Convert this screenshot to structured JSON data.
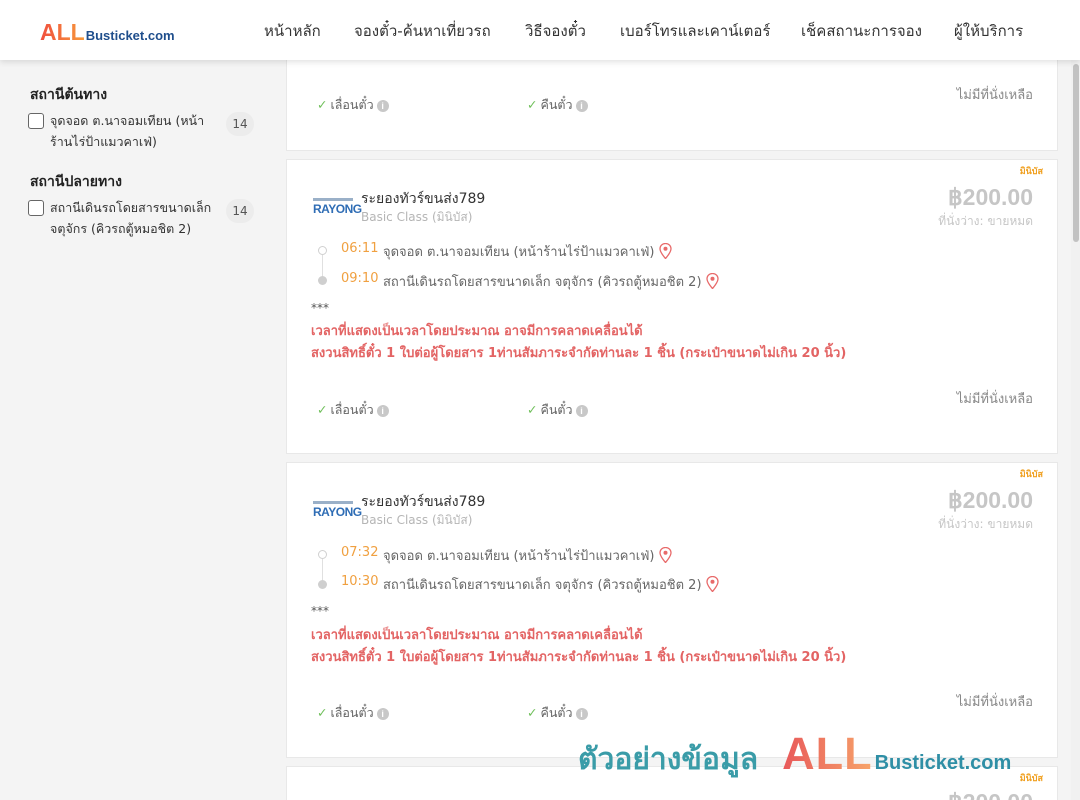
{
  "header": {
    "logo_all": "ALL",
    "logo_rest": "Busticket.com",
    "nav": [
      "หน้าหลัก",
      "จองตั๋ว-ค้นหาเที่ยวรถ",
      "วิธีจองตั๋ว",
      "เบอร์โทรและเคาน์เตอร์",
      "เช็คสถานะการจอง",
      "ผู้ให้บริการ"
    ]
  },
  "sidebar": {
    "origin_heading": "สถานีต้นทาง",
    "origin_label": "จุดจอด ต.นาจอมเทียน (หน้าร้านไร่ป้าแมวคาเฟ่)",
    "origin_count": "14",
    "dest_heading": "สถานีปลายทาง",
    "dest_label": "สถานีเดินรถโดยสารขนาดเล็ก จตุจักร (คิวรถตู้หมอชิต 2)",
    "dest_count": "14"
  },
  "common": {
    "badge": "มินิบัส",
    "operator_logo": "RAYONG",
    "operator": "ระยองทัวร์ขนส่ง789",
    "class": "Basic Class (มินิบัส)",
    "price": "฿200.00",
    "seats": "ที่นั่งว่าง: ขายหมด",
    "from_stop": "จุดจอด ต.นาจอมเทียน (หน้าร้านไร่ป้าแมวคาเฟ่)",
    "to_stop": "สถานีเดินรถโดยสารขนาดเล็ก จตุจักร (คิวรถตู้หมอชิต 2)",
    "stars": "***",
    "note1": "เวลาที่แสดงเป็นเวลาโดยประมาณ อาจมีการคลาดเคลื่อนได้",
    "note2": "สงวนสิทธิ์ตั๋ว 1 ใบต่อผู้โดยสาร 1ท่านสัมภาระจำกัดท่านละ 1 ชิ้น (กระเป๋าขนาดไม่เกิน 20 นิ้ว)",
    "reschedule": "เลื่อนตั๋ว",
    "refund": "คืนตั๋ว",
    "no_seat": "ไม่มีที่นั่งเหลือ"
  },
  "trips": [
    {
      "depart": "06:11",
      "arrive": "09:10"
    },
    {
      "depart": "07:32",
      "arrive": "10:30"
    }
  ],
  "partial_price": "฿200.00",
  "watermark": {
    "thai": "ตัวอย่างข้อมูล",
    "all": "ALL",
    "rest": "Busticket.com"
  }
}
